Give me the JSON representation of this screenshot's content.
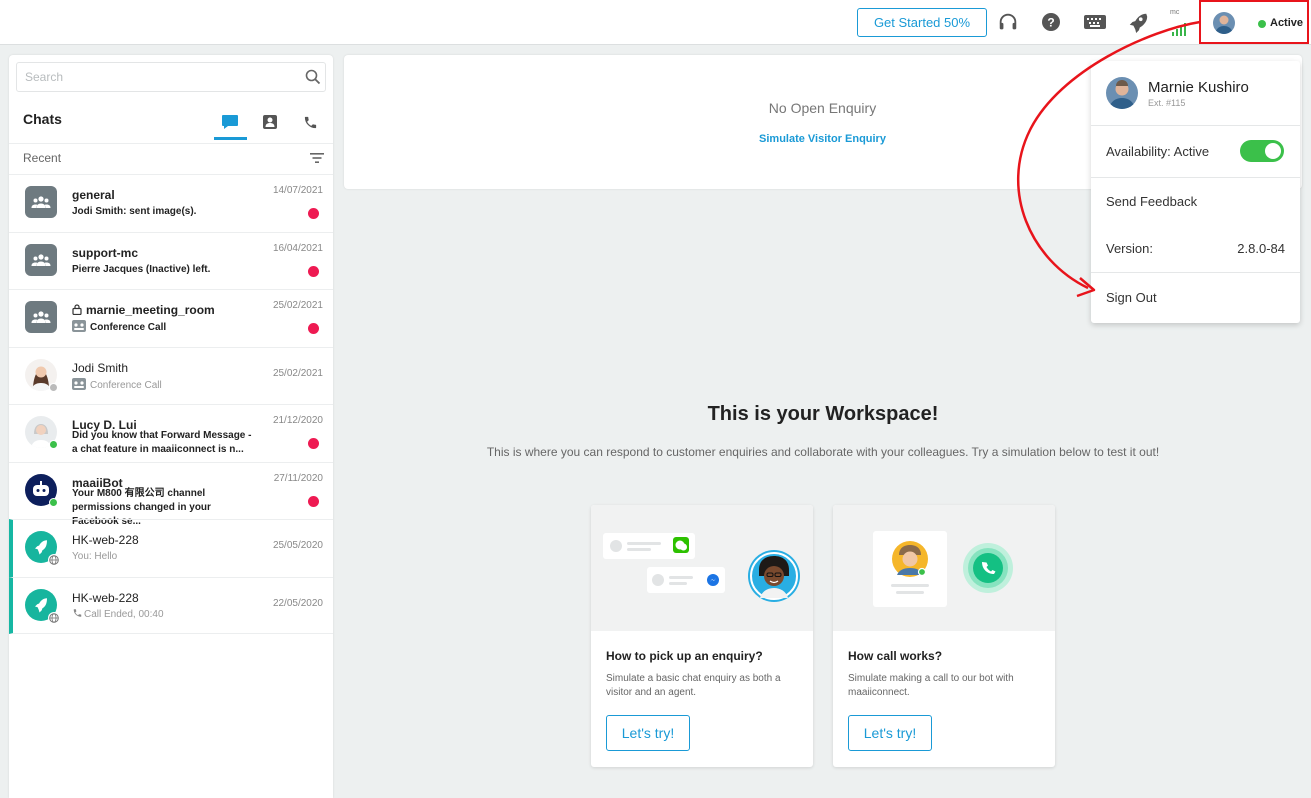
{
  "topbar": {
    "get_started_label": "Get Started 50%",
    "signal_label": "mc",
    "status_label": "Active"
  },
  "sidebar": {
    "search_placeholder": "Search",
    "title": "Chats",
    "recent_label": "Recent",
    "chats": [
      {
        "name": "general",
        "message": "Jodi Smith:  sent image(s).",
        "date": "14/07/2021",
        "unread": true
      },
      {
        "name": "support-mc",
        "message": "Pierre Jacques (Inactive) left.",
        "date": "16/04/2021",
        "unread": true
      },
      {
        "name": "marnie_meeting_room",
        "message": "Conference Call",
        "date": "25/02/2021",
        "unread": true
      },
      {
        "name": "Jodi Smith",
        "message": "Conference Call",
        "date": "25/02/2021",
        "unread": false
      },
      {
        "name": "Lucy D. Lui",
        "message": "Did you know that Forward Message - a chat feature in maaiiconnect is n...",
        "date": "21/12/2020",
        "unread": true
      },
      {
        "name": "maaiiBot",
        "message": "Your M800 有限公司 channel permissions changed in your Facebook se...",
        "date": "27/11/2020",
        "unread": true
      },
      {
        "name": "HK-web-228",
        "message": "You: Hello",
        "date": "25/05/2020",
        "unread": false
      },
      {
        "name": "HK-web-228",
        "message": "Call Ended, 00:40",
        "date": "22/05/2020",
        "unread": false
      }
    ]
  },
  "main": {
    "no_open_enquiry": "No Open Enquiry",
    "simulate_link": "Simulate Visitor Enquiry",
    "workspace_title": "This is your Workspace!",
    "workspace_subtitle": "This is where you can respond to customer enquiries and collaborate with your colleagues. Try a simulation below to test it out!",
    "cards": [
      {
        "title": "How to pick up an enquiry?",
        "description": "Simulate a basic chat enquiry as both a visitor and an agent.",
        "button": "Let's try!"
      },
      {
        "title": "How call works?",
        "description": "Simulate making a call to our bot with maaiiconnect.",
        "button": "Let's try!"
      }
    ]
  },
  "dropdown": {
    "user_name": "Marnie Kushiro",
    "extension": "Ext. #115",
    "availability_label": "Availability: Active",
    "availability_on": true,
    "send_feedback": "Send Feedback",
    "version_label": "Version:",
    "version_value": "2.8.0-84",
    "sign_out": "Sign Out"
  },
  "colors": {
    "accent": "#1a9ad6",
    "active_green": "#3bc04a",
    "unread_red": "#ee1a52",
    "highlight_teal": "#16b7a3",
    "annotation_red": "#e8141b"
  }
}
